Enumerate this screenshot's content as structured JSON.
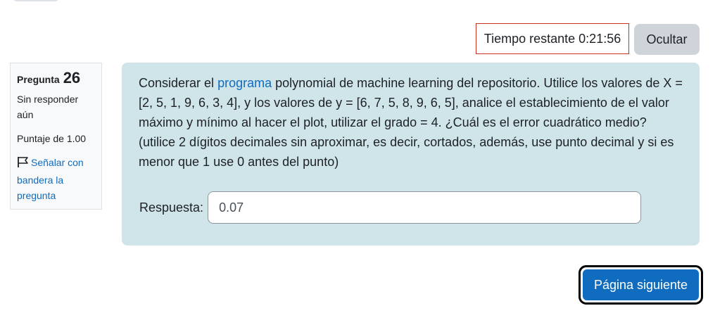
{
  "timer": {
    "label": "Tiempo restante",
    "value": "0:21:56"
  },
  "hide_button_label": "Ocultar",
  "question_info": {
    "title_word": "Pregunta",
    "number": "26",
    "state": "Sin responder aún",
    "grade": "Puntaje de 1.00",
    "flag_label": "Señalar con bandera la pregunta",
    "flag_icon": "flag-outline-icon"
  },
  "question": {
    "text_before_link": "Considerar el ",
    "link_text": "programa",
    "text_after_link": " polynomial de machine learning del repositorio. Utilice los valores de X = [2, 5, 1, 9, 6, 3, 4], y los valores de y = [6, 7, 5, 8, 9, 6, 5], analice el establecimiento de el valor máximo y mínimo al hacer el plot, utilizar el grado = 4. ¿Cuál es el error cuadrático medio? (utilice 2 dígitos decimales sin aproximar, es decir, cortados, además, use punto decimal y si es menor que 1 use 0 antes del punto)"
  },
  "answer": {
    "label": "Respuesta:",
    "value": "0.07"
  },
  "next_button_label": "Página siguiente",
  "colors": {
    "primary": "#0f6cbf",
    "question_bg": "#cfe5ea",
    "timer_border": "#ca3120",
    "secondary_button": "#ced4da"
  }
}
